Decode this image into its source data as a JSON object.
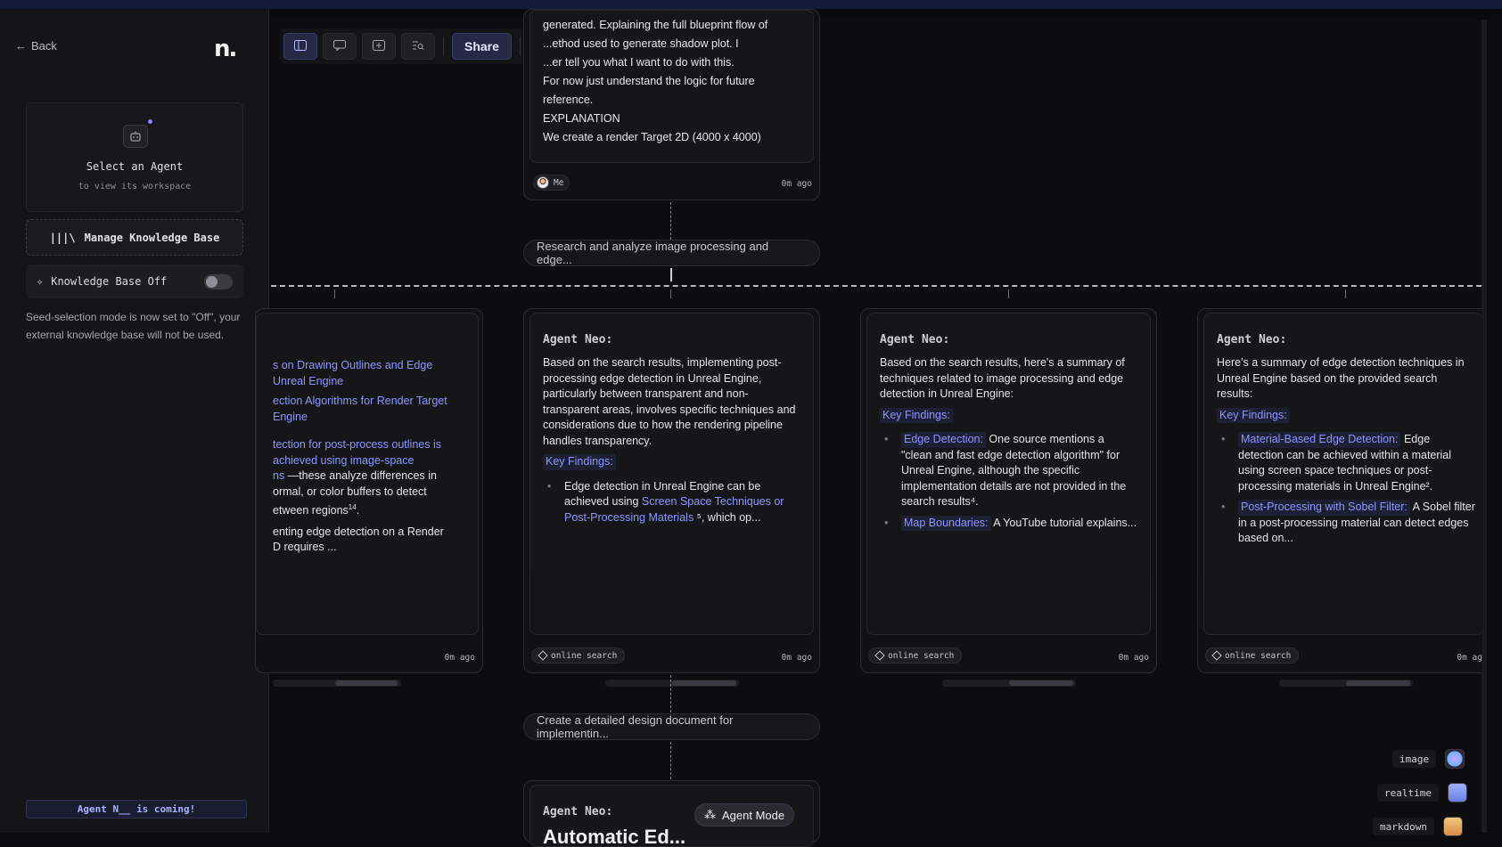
{
  "sidebar": {
    "back_label": "Back",
    "logo": "n.",
    "agent_card": {
      "title": "Select an Agent",
      "subtitle": "to view its workspace"
    },
    "manage_kb_label": "Manage Knowledge Base",
    "kb_toggle_label": "Knowledge Base Off",
    "kb_note": "Seed-selection mode is now set to \"Off\", your external knowledge base will not be used.",
    "coming_soon": "Agent N__ is coming!"
  },
  "toolbar": {
    "share_label": "Share"
  },
  "top_message": {
    "lines": [
      "generated. Explaining the full blueprint flow of",
      "...ethod used to generate shadow plot. I",
      "...er tell you what I want to do with this.",
      "For now just understand the logic for future",
      "reference.",
      "EXPLANATION",
      "We create a render Target 2D (4000 x 4000)"
    ],
    "author": "Me",
    "time": "0m ago"
  },
  "prompt1": "Research and analyze image processing and edge...",
  "prompt2": "Create a detailed design document for implementin...",
  "cards": [
    {
      "frag": [
        "s on Drawing Outlines and Edge",
        "Unreal Engine",
        "ection Algorithms for Render Target",
        "Engine",
        "tection for post-process outlines is",
        "achieved using image-space",
        "ns",
        "—these analyze differences in",
        "ormal, or color buffers to detect",
        "etween regions",
        "enting edge detection on a Render",
        "D requires ..."
      ],
      "time": "0m ago"
    },
    {
      "head": "Agent Neo:",
      "intro": "Based on the search results, implementing post-processing edge detection in Unreal Engine, particularly between transparent and non-transparent areas, involves specific techniques and considerations due to how the rendering pipeline handles transparency.",
      "kf": "Key Findings:",
      "b1_pre": "Edge detection in Unreal Engine can be achieved using ",
      "b1_link": "Screen Space Techniques or Post-Processing Materials",
      "b1_post": " ⁵, which op...",
      "tag": "online search",
      "time": "0m ago"
    },
    {
      "head": "Agent Neo:",
      "intro": "Based on the search results, here's a summary of techniques related to image processing and edge detection in Unreal Engine:",
      "kf": "Key Findings:",
      "b1_link": "Edge Detection:",
      "b1_post": " One source mentions a \"clean and fast edge detection algorithm\" for Unreal Engine, although the specific implementation details are not provided in the search results⁴.",
      "b2_link": "Map Boundaries:",
      "b2_post": " A YouTube tutorial explains...",
      "tag": "online search",
      "time": "0m ago"
    },
    {
      "head": "Agent Neo:",
      "intro": "Here's a summary of edge detection techniques in Unreal Engine based on the provided search results:",
      "kf": "Key Findings:",
      "b1_link": "Material-Based Edge Detection:",
      "b1_post": " Edge detection can be achieved within a material using screen space techniques or post-processing materials in Unreal Engine².",
      "b2_link": "Post-Processing with Sobel Filter:",
      "b2_post": " A Sobel filter in a post-processing material can detect edges based on...",
      "tag": "online search",
      "time": "0m ag"
    }
  ],
  "bottom_card": {
    "head": "Agent Neo:",
    "title_partial": "Automatic Ed..."
  },
  "agent_mode": "Agent Mode",
  "output_types": [
    "image",
    "realtime",
    "markdown"
  ]
}
